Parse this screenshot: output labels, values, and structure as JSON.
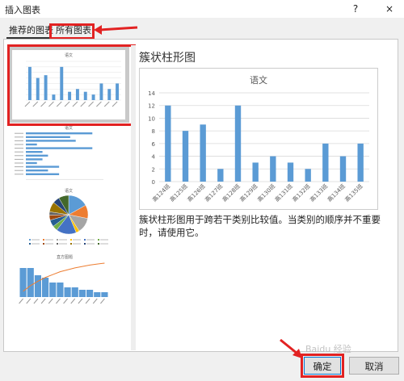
{
  "window": {
    "title": "插入图表",
    "help_label": "?",
    "close_label": "×"
  },
  "tabs": [
    {
      "label": "推荐的图表",
      "active": true
    },
    {
      "label": "所有图表",
      "active": false
    }
  ],
  "selected_chart": {
    "name": "簇状柱形图",
    "description": "簇状柱形图用于跨若干类别比较值。当类别的顺序并不重要时，请使用它。"
  },
  "thumbnails": [
    {
      "name": "簇状柱形图",
      "title": "语文",
      "selected": true
    },
    {
      "name": "簇状条形图",
      "title": "语文",
      "selected": false
    },
    {
      "name": "饼图",
      "title": "语文",
      "selected": false
    },
    {
      "name": "排列图",
      "title": "直方图题",
      "selected": false
    }
  ],
  "chart_data": {
    "type": "bar",
    "title": "语文",
    "categories": [
      "高124班",
      "高125班",
      "高126班",
      "高127班",
      "高128班",
      "高129班",
      "高130班",
      "高131班",
      "高132班",
      "高133班",
      "高134班",
      "高135班"
    ],
    "values": [
      12,
      8,
      9,
      2,
      12,
      3,
      4,
      3,
      2,
      6,
      4,
      6
    ],
    "ylim": [
      0,
      14
    ],
    "yticks": [
      0,
      2,
      4,
      6,
      8,
      10,
      12,
      14
    ],
    "grid": true,
    "bar_color": "#5b9bd5"
  },
  "buttons": {
    "ok": "确定",
    "cancel": "取消"
  },
  "colors": {
    "annotation": "#e22222",
    "accent": "#0078d7"
  },
  "watermark": "Baidu 经验"
}
